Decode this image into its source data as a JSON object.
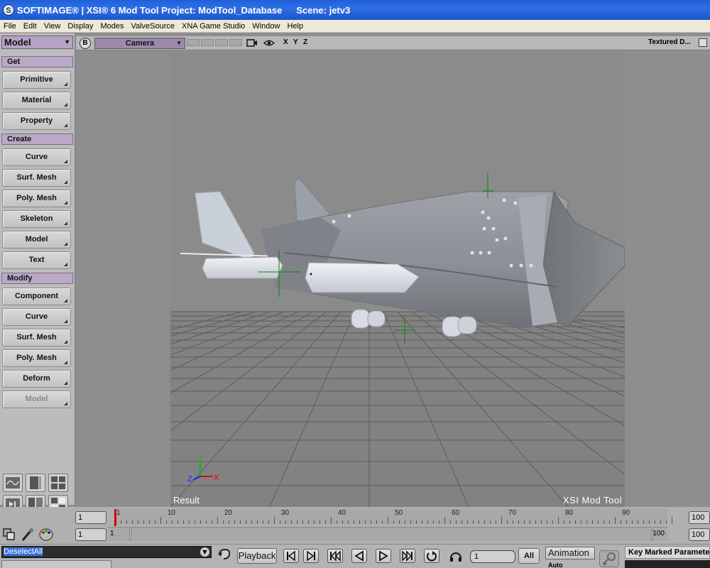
{
  "window": {
    "logo_letter": "S",
    "title": "SOFTIMAGE® | XSI® 6 Mod Tool Project: ModTool_Database",
    "scene": "Scene: jetv3"
  },
  "menu": [
    "File",
    "Edit",
    "View",
    "Display",
    "Modes",
    "ValveSource",
    "XNA Game Studio",
    "Window",
    "Help"
  ],
  "left_panel": {
    "mode": "Model",
    "get_header": "Get",
    "get_buttons": [
      "Primitive",
      "Material",
      "Property"
    ],
    "create_header": "Create",
    "create_buttons": [
      "Curve",
      "Surf. Mesh",
      "Poly. Mesh",
      "Skeleton",
      "Model",
      "Text"
    ],
    "modify_header": "Modify",
    "modify_buttons": [
      "Component",
      "Curve",
      "Surf. Mesh",
      "Poly. Mesh",
      "Deform",
      "Model"
    ]
  },
  "viewport_toolbar": {
    "letter": "B",
    "camera": "Camera",
    "axes": [
      "X",
      "Y",
      "Z"
    ],
    "display_mode": "Textured D..."
  },
  "viewport": {
    "result_label": "Result",
    "watermark": "XSI  Mod  Tool",
    "axis_labels": [
      "Y",
      "Z",
      "X"
    ],
    "colors": {
      "background": "#8a8a8a",
      "grid": "#5a5a5a",
      "fuselage": "#8e9196",
      "highlight": "#c8ccd4",
      "axis_x": "#e00000",
      "axis_y": "#00c000",
      "axis_z": "#2020ff",
      "crosshair": "#009000"
    }
  },
  "timeline": {
    "current_frame_left": "1",
    "start_frame_left": "1",
    "ticks": [
      "1",
      "10",
      "20",
      "30",
      "40",
      "50",
      "60",
      "70",
      "80",
      "90"
    ],
    "end_frame": "100",
    "range_start": "1",
    "range_end": "100",
    "range_end_field": "100"
  },
  "bottom": {
    "script_command": "DeselectAll",
    "playback_label": "Playback",
    "current_frame": "1",
    "all_label": "All",
    "animation_label": "Animation",
    "auto_label": "Auto",
    "key_marked": "Key Marked Parameters"
  }
}
